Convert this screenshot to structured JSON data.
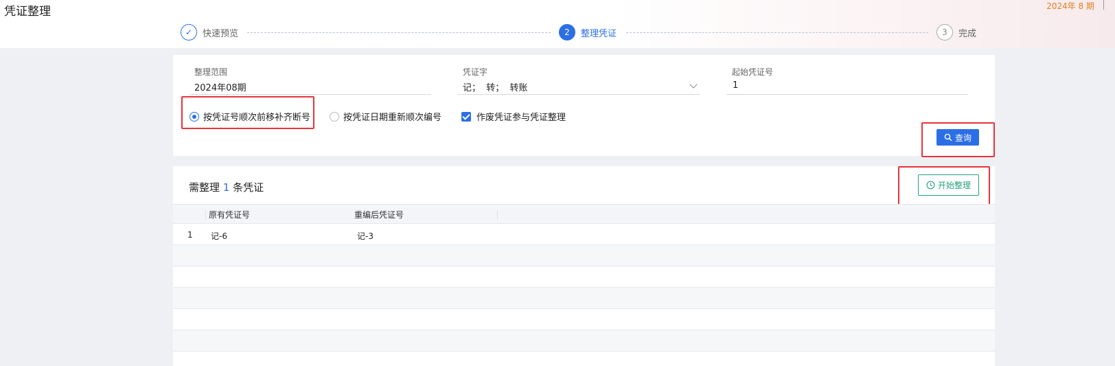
{
  "header": {
    "title": "凭证整理",
    "period": "2024年 8 期"
  },
  "steps": [
    {
      "num": "✓",
      "label": "快速预览",
      "state": "done"
    },
    {
      "num": "2",
      "label": "整理凭证",
      "state": "active"
    },
    {
      "num": "3",
      "label": "完成",
      "state": "todo"
    }
  ],
  "filters": {
    "range_label": "整理范围",
    "range_value": "2024年08期",
    "word_label": "凭证字",
    "word_value": "记；  转；  转账",
    "start_label": "起始凭证号",
    "start_value": "1"
  },
  "options": {
    "radio1": "按凭证号顺次前移补齐断号",
    "radio2": "按凭证日期重新顺次编号",
    "checkbox": "作废凭证参与凭证整理"
  },
  "buttons": {
    "query": "查询",
    "start": "开始整理"
  },
  "summary": {
    "prefix": "需整理",
    "count": "1",
    "suffix": "条凭证"
  },
  "table": {
    "columns": [
      "原有凭证号",
      "重编后凭证号"
    ],
    "rows": [
      {
        "index": "1",
        "original": "记-6",
        "renumbered": "记-3"
      }
    ]
  },
  "colors": {
    "primary": "#2b6fe6",
    "accent_orange": "#e0801f",
    "highlight_red": "#e8323a",
    "start_green": "#27a27d"
  }
}
